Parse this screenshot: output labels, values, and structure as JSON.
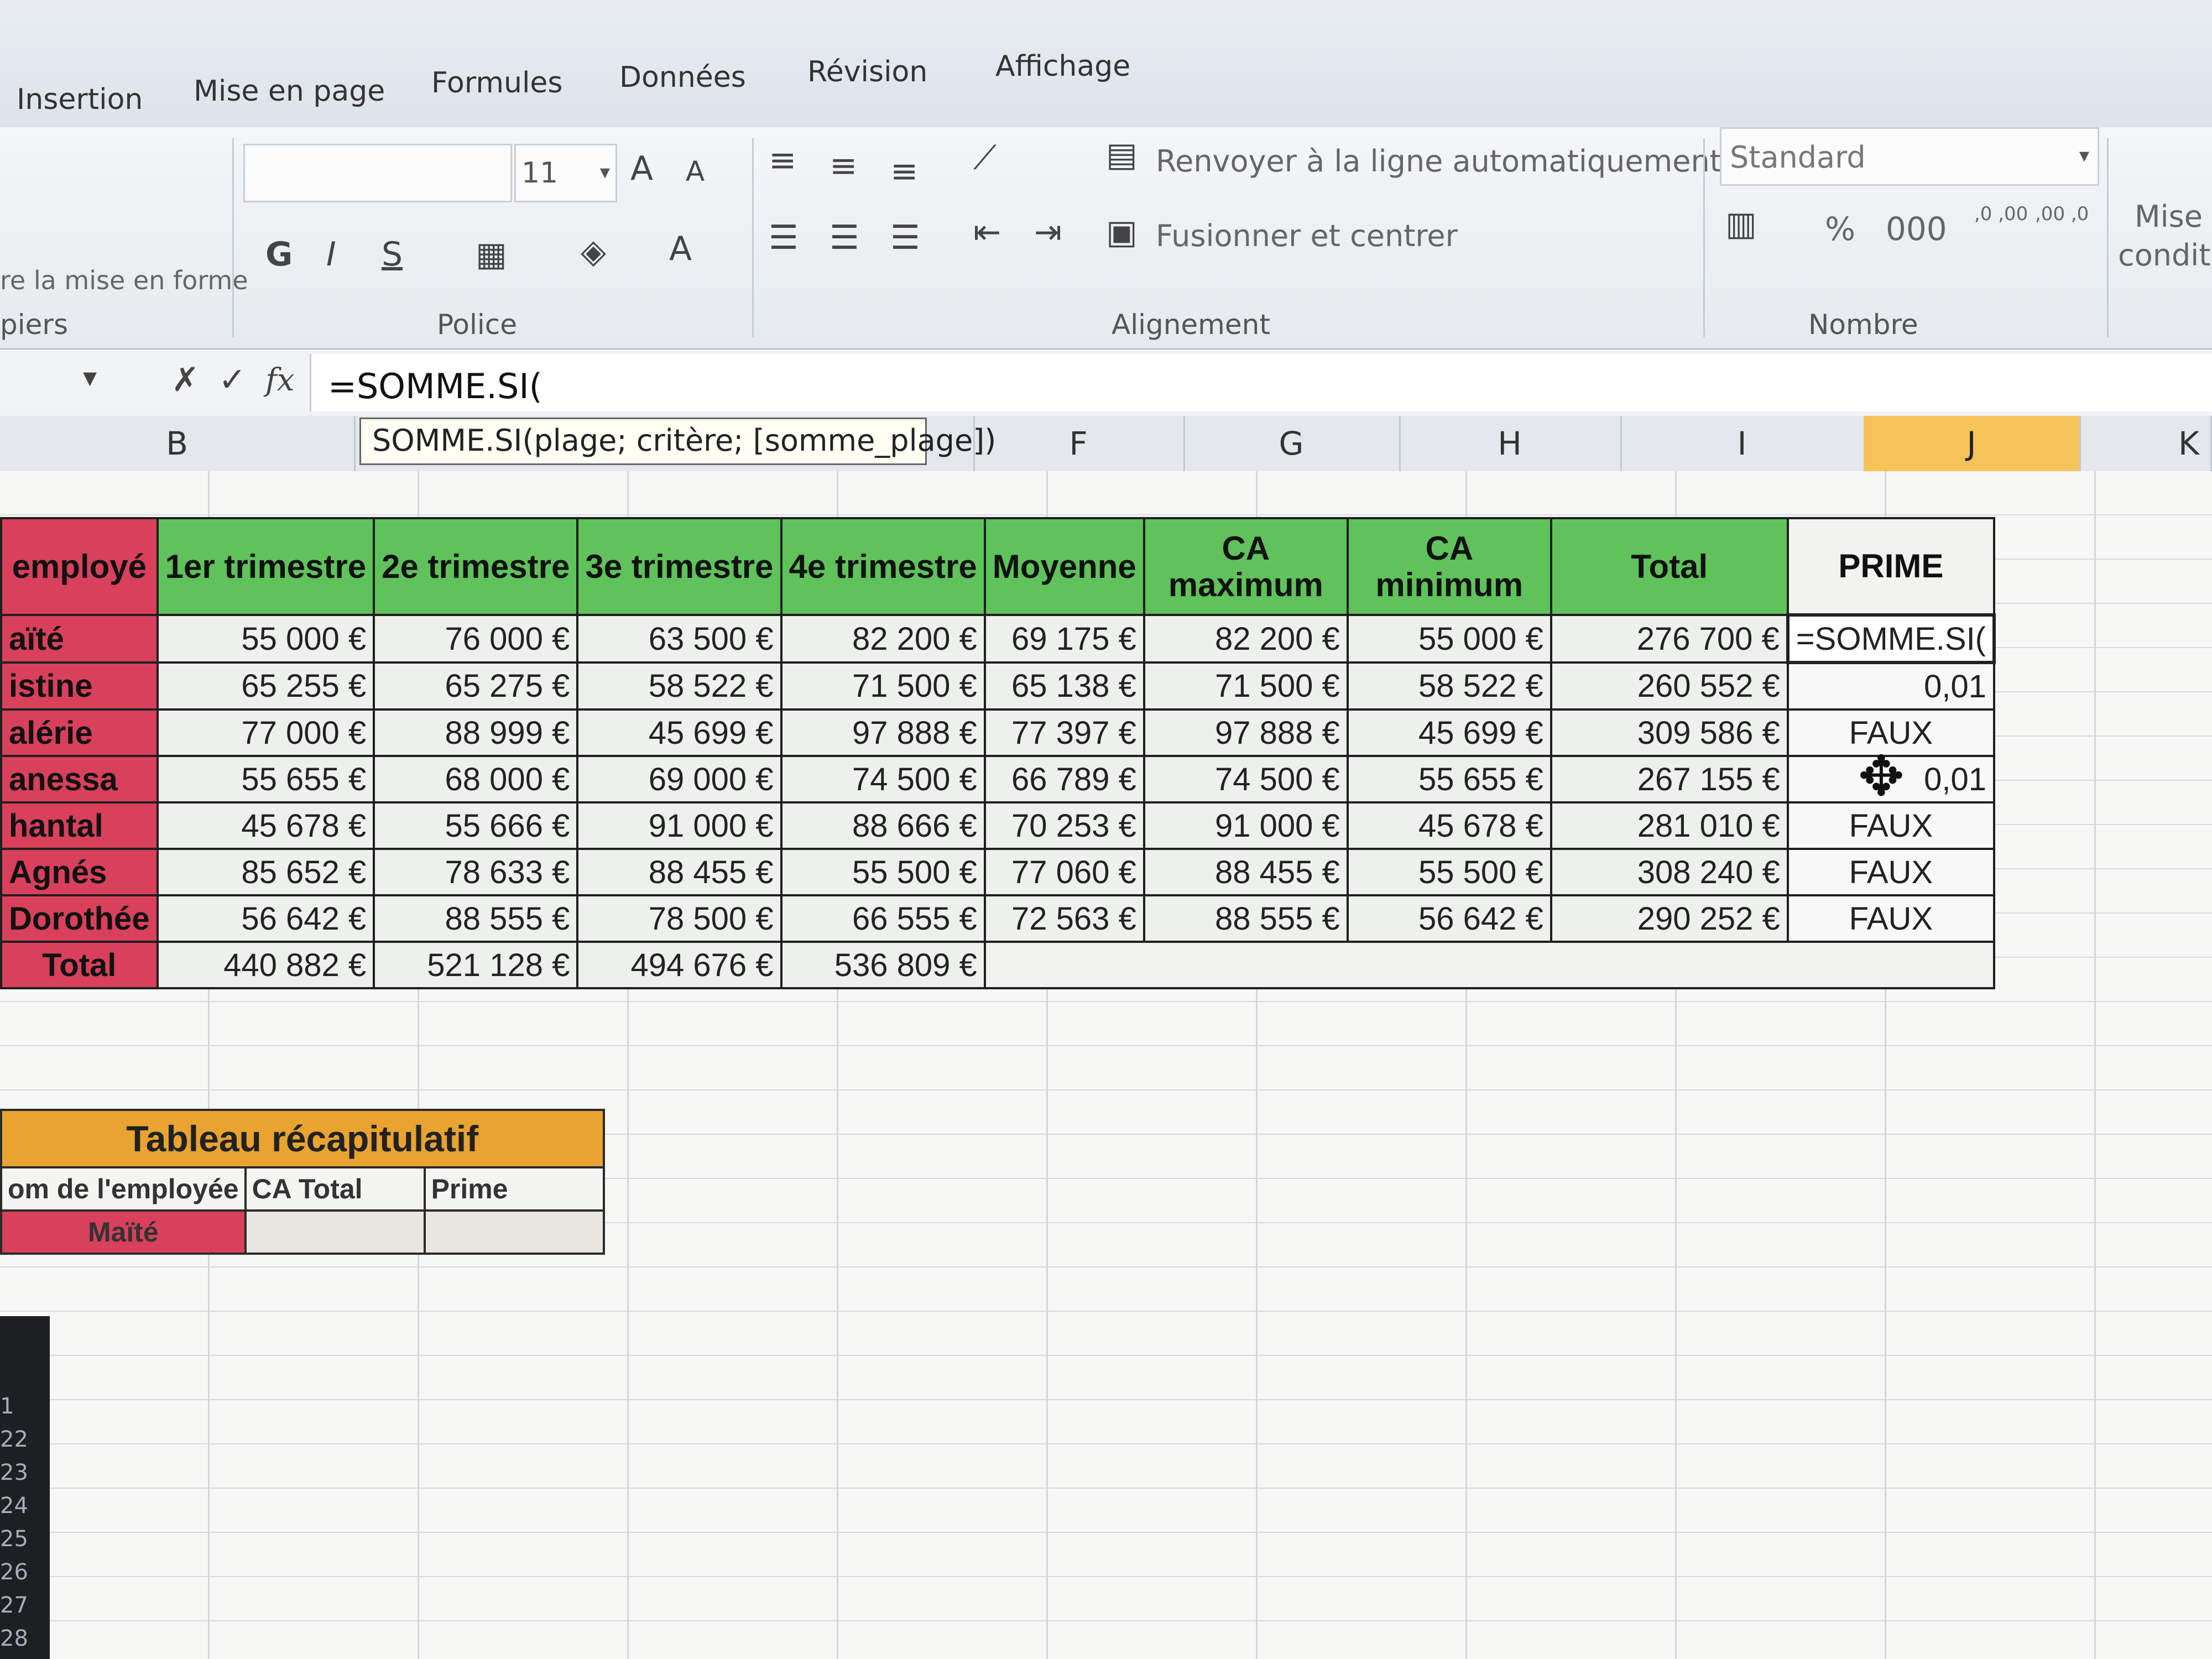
{
  "menu": {
    "tabs": [
      "Insertion",
      "Mise en page",
      "Formules",
      "Données",
      "Révision",
      "Affichage"
    ]
  },
  "ribbon": {
    "clipboard": {
      "format_painter": "re la mise en forme",
      "label": "piers"
    },
    "font": {
      "label": "Police",
      "size": "11",
      "bold": "G",
      "italic": "I",
      "underline": "S",
      "grow": "A",
      "shrink": "A",
      "color": "A"
    },
    "alignment": {
      "label": "Alignement",
      "wrap_text": "Renvoyer à la ligne automatiquement",
      "merge_center": "Fusionner et centrer"
    },
    "number": {
      "label": "Nombre",
      "format": "Standard",
      "percent": "%",
      "thousands": "000",
      "inc_decimal": ",0 ,00",
      "dec_decimal": ",00 ,0"
    },
    "styles": {
      "conditional": "Mise",
      "conditional2": "condit"
    }
  },
  "formula_bar": {
    "cancel": "✗",
    "enter": "✓",
    "fx": "fx",
    "content": "=SOMME.SI("
  },
  "tooltip": "SOMME.SI(plage; critère; [somme_plage])",
  "columns": [
    "B",
    "F",
    "G",
    "H",
    "I",
    "J",
    "K"
  ],
  "table": {
    "headers": [
      "employé",
      "1er trimestre",
      "2e trimestre",
      "3e trimestre",
      "4e trimestre",
      "Moyenne",
      "CA maximum",
      "CA minimum",
      "Total",
      "PRIME"
    ],
    "rows": [
      {
        "name": "aïté",
        "values": [
          "55 000 €",
          "76 000 €",
          "63 500 €",
          "82 200 €",
          "69 175 €",
          "82 200 €",
          "55 000 €",
          "276 700 €"
        ],
        "prime": "=SOMME.SI("
      },
      {
        "name": "istine",
        "values": [
          "65 255 €",
          "65 275 €",
          "58 522 €",
          "71 500 €",
          "65 138 €",
          "71 500 €",
          "58 522 €",
          "260 552 €"
        ],
        "prime": "0,01"
      },
      {
        "name": "alérie",
        "values": [
          "77 000 €",
          "88 999 €",
          "45 699 €",
          "97 888 €",
          "77 397 €",
          "97 888 €",
          "45 699 €",
          "309 586 €"
        ],
        "prime": "FAUX"
      },
      {
        "name": "anessa",
        "values": [
          "55 655 €",
          "68 000 €",
          "69 000 €",
          "74 500 €",
          "66 789 €",
          "74 500 €",
          "55 655 €",
          "267 155 €"
        ],
        "prime": "0,01"
      },
      {
        "name": "hantal",
        "values": [
          "45 678 €",
          "55 666 €",
          "91 000 €",
          "88 666 €",
          "70 253 €",
          "91 000 €",
          "45 678 €",
          "281 010 €"
        ],
        "prime": "FAUX"
      },
      {
        "name": "Agnés",
        "values": [
          "85 652 €",
          "78 633 €",
          "88 455 €",
          "55 500 €",
          "77 060 €",
          "88 455 €",
          "55 500 €",
          "308 240 €"
        ],
        "prime": "FAUX"
      },
      {
        "name": "Dorothée",
        "values": [
          "56 642 €",
          "88 555 €",
          "78 500 €",
          "66 555 €",
          "72 563 €",
          "88 555 €",
          "56 642 €",
          "290 252 €"
        ],
        "prime": "FAUX"
      }
    ],
    "total": {
      "name": "Total",
      "values": [
        "440 882 €",
        "521 128 €",
        "494 676 €",
        "536 809 €"
      ]
    }
  },
  "summary": {
    "title": "Tableau récapitulatif",
    "headers": [
      "om de l'employée",
      "CA Total",
      "Prime"
    ],
    "row": {
      "name": "Maïté",
      "ca_total": "",
      "prime": ""
    }
  },
  "row_numbers": [
    "1",
    "22",
    "23",
    "24",
    "25",
    "26",
    "27",
    "28"
  ],
  "colors": {
    "accent_green": "#5fc25a",
    "accent_red": "#d8405c",
    "accent_orange": "#e8a330",
    "active_col": "#f5c35a"
  }
}
